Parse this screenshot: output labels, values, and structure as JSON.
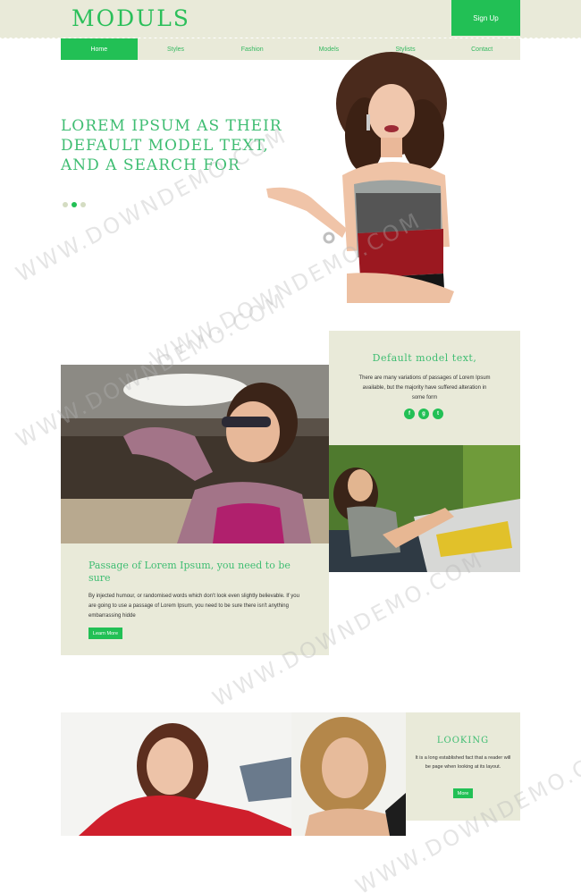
{
  "header": {
    "logo": "MODULS",
    "signup_label": "Sign Up"
  },
  "nav": {
    "items": [
      {
        "label": "Home"
      },
      {
        "label": "Styles"
      },
      {
        "label": "Fashion"
      },
      {
        "label": "Models"
      },
      {
        "label": "Stylists"
      },
      {
        "label": "Contact"
      }
    ],
    "active": "Home"
  },
  "hero": {
    "headline": "LOREM IPSUM AS THEIR DEFAULT MODEL TEXT, AND A SEARCH FOR",
    "slides": 3,
    "active_slide": 2
  },
  "feature_a": {
    "title": "Passage of Lorem Ipsum, you need to be sure",
    "body": "By injected humour, or randomised words which don't look even slightly believable. If you are going to use a passage of Lorem Ipsum, you need to be sure there isn't anything embarrassing hidde",
    "button": "Learn More"
  },
  "feature_b": {
    "title": "Default model text,",
    "body": "There are many variations of passages of Lorem Ipsum available, but the majority have suffered alteration in some form",
    "socials": [
      {
        "icon": "facebook-icon",
        "glyph": "f"
      },
      {
        "icon": "google-plus-icon",
        "glyph": "g"
      },
      {
        "icon": "twitter-icon",
        "glyph": "t"
      }
    ]
  },
  "feature_c": {
    "title": "LOOKING",
    "body": "It is a long established fact that a reader will be page when looking at its layout.",
    "button": "More"
  },
  "watermark": "WWW.DOWNDEMO.COM",
  "colors": {
    "accent": "#22c055",
    "panel": "#e9ead9",
    "heading": "#3fbd72"
  }
}
